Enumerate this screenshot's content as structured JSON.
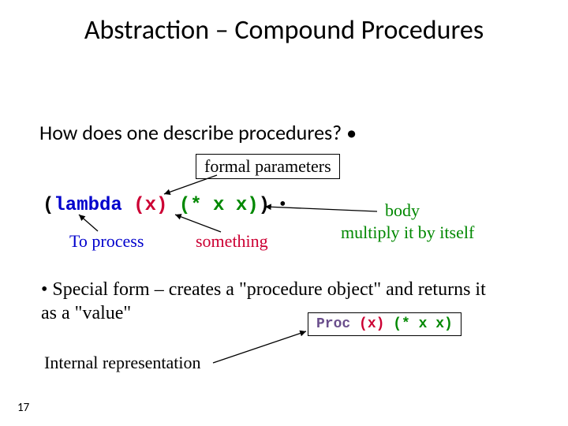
{
  "title": "Abstraction – Compound Procedures",
  "subtitle": "How does one describe procedures?  •",
  "formal_label": "formal parameters",
  "code": {
    "paren1": "(",
    "lambda": "lambda",
    "params": " (x)",
    "body": " (* x x)",
    "paren2": ")",
    "bullet": "  •"
  },
  "annotations": {
    "to_process": "To process",
    "something": "something",
    "body": "body",
    "multiply": "multiply it by itself"
  },
  "special_form": "• Special form – creates a \"procedure object\" and returns it as a \"value\"",
  "proc_box": {
    "a": "Proc",
    "b": " (x)",
    "c": " (* x x)"
  },
  "internal_rep": "Internal representation",
  "page_number": "17"
}
